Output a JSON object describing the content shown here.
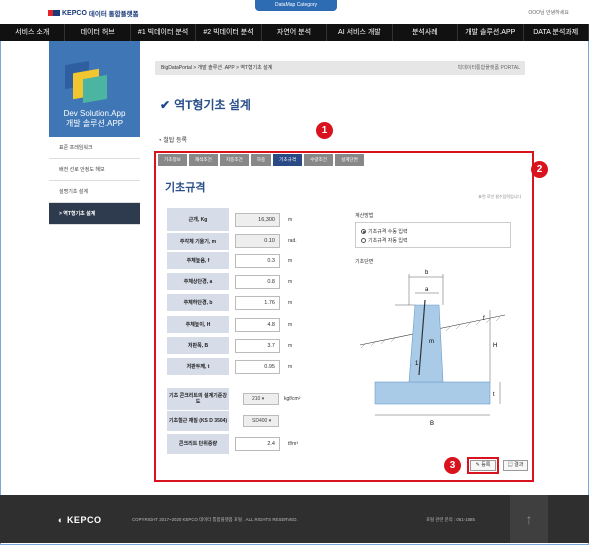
{
  "header": {
    "logo_text": "KEPCO",
    "logo_sub": "데이터 통합플랫폼",
    "datamap_tab": "DataMap Category",
    "greeting": "OOO님 안녕하세요"
  },
  "nav": [
    "서비스 소개",
    "데이터 허브",
    "#1 빅데이터 분석",
    "#2 빅데이터 분석",
    "자연어 분석",
    "AI 서비스 개발",
    "분석사례",
    "개발 솔루션.APP",
    "DATA 분석과제"
  ],
  "sidebar": {
    "title_line1": "Dev Solution.App",
    "title_line2": "개발 솔루션.APP",
    "items": [
      "표준 프레임워크",
      "배전 선로 안정도 해보",
      "설명기초 설계",
      "> 역T형기초 설계"
    ]
  },
  "breadcrumb": {
    "path": "BigDataPortal > 개발 솔루션 .APP > 역T형기초 설계",
    "right": "빅데이터통합플랫폼 PORTAL"
  },
  "page": {
    "title": "역T형기초 설계",
    "section": "철탑 등록",
    "tabs": [
      "기초정보",
      "재석조건",
      "지중조건",
      "하중",
      "기초규격",
      "수량조건",
      "설계단면"
    ],
    "form_title": "기초규격",
    "note": "표련 로안 필수입력입니다"
  },
  "fields": [
    {
      "label": "근개, Kg",
      "value": "16,300",
      "unit": "m",
      "readonly": true
    },
    {
      "label": "주각체 기울기, m",
      "value": "0.10",
      "unit": "rad.",
      "readonly": true
    },
    {
      "label": "주체높음, f",
      "value": "0.3",
      "unit": "m",
      "readonly": false
    },
    {
      "label": "주체상단경, a",
      "value": "0.8",
      "unit": "m",
      "readonly": false
    },
    {
      "label": "주체하단경, b",
      "value": "1.76",
      "unit": "m",
      "readonly": false
    },
    {
      "label": "주체높이, H",
      "value": "4.8",
      "unit": "m",
      "readonly": false
    },
    {
      "label": "저판폭, B",
      "value": "3.7",
      "unit": "m",
      "readonly": false
    },
    {
      "label": "저판두께, t",
      "value": "0.95",
      "unit": "m",
      "readonly": false
    }
  ],
  "extra_fields": {
    "concrete_label": "기초 콘크리트의 설계기준강도",
    "concrete_value": "210",
    "concrete_unit": "kgf/cm²",
    "rebar_label": "기초철근 재질 (KS D 3504)",
    "rebar_value": "SD400",
    "density_label": "콘크리트 단위중량",
    "density_value": "2.4",
    "density_unit": "tf/m³"
  },
  "calc": {
    "label": "계산방법",
    "option1": "기초규격 수동 입력",
    "option2": "기초규격 자동 입력",
    "section_label": "기초단면"
  },
  "diagram_labels": {
    "b": "b",
    "a": "a",
    "f": "f",
    "m": "m",
    "one": "1",
    "H": "H",
    "t": "t",
    "B": "B"
  },
  "buttons": {
    "save": "등록",
    "result": "결과"
  },
  "badges": {
    "one": "1",
    "two": "2",
    "three": "3"
  },
  "footer": {
    "logo": "KEPCO",
    "copyright": "COPYRIGHT 2017~2020 KEPCO 데이터 통합플랫폼 포털 . ALL RIGHTS RESERVED.",
    "contact": "포털 관련 문의 : 061-1585"
  }
}
